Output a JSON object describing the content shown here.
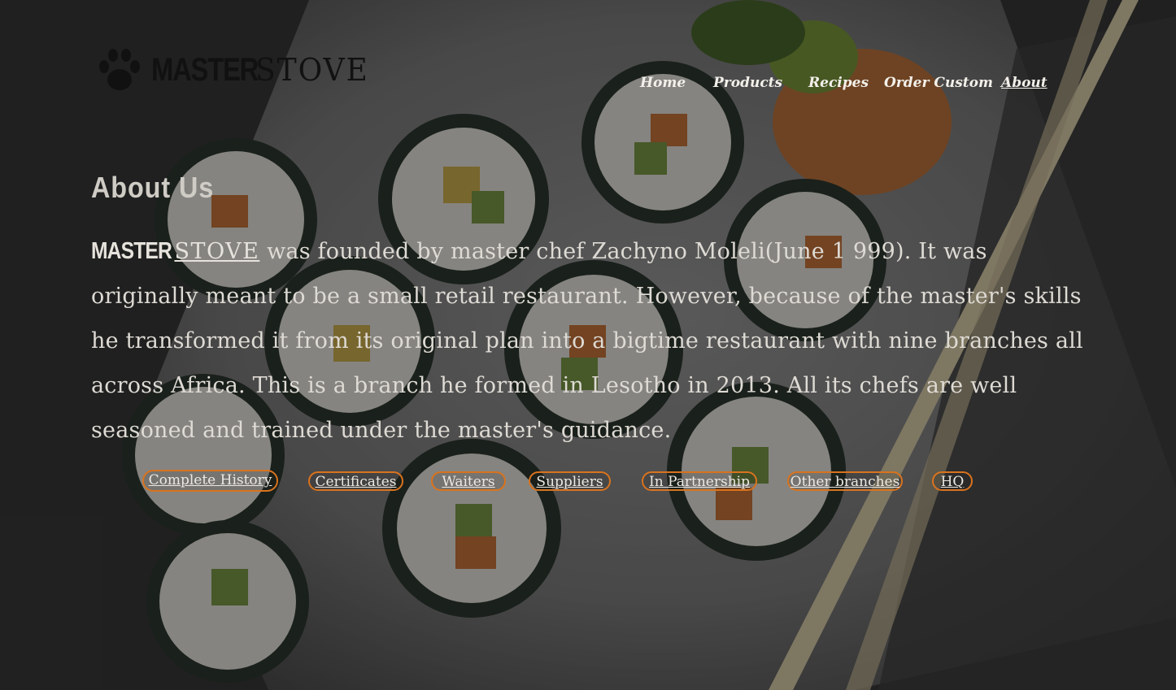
{
  "brand": {
    "bold": "MASTER",
    "light": "STOVE"
  },
  "nav": {
    "items": [
      {
        "label": "Home"
      },
      {
        "label": "Products"
      },
      {
        "label": "Recipes"
      },
      {
        "label": "Order Custom"
      },
      {
        "label": "About"
      }
    ],
    "active": "About"
  },
  "about": {
    "title": "About Us",
    "brand_bold": "MASTER",
    "brand_light": "STOVE",
    "body": " was founded by master chef Zachyno Moleli(June 1 999). It was originally meant to be a small retail restaurant. However, because of the master's skills he transformed it from its original plan into a bigtime restaurant with nine branches all across Africa. This is a branch he formed in Lesotho in 2013. All its chefs are well seasoned and trained under the master's guidance."
  },
  "links": [
    {
      "label": "Complete History"
    },
    {
      "label": "Certificates"
    },
    {
      "label": "Waiters"
    },
    {
      "label": "Suppliers"
    },
    {
      "label": "In Partnership"
    },
    {
      "label": "Other branches"
    },
    {
      "label": "HQ"
    }
  ],
  "colors": {
    "pill_border": "#d9731e",
    "text": "#dedad4"
  }
}
